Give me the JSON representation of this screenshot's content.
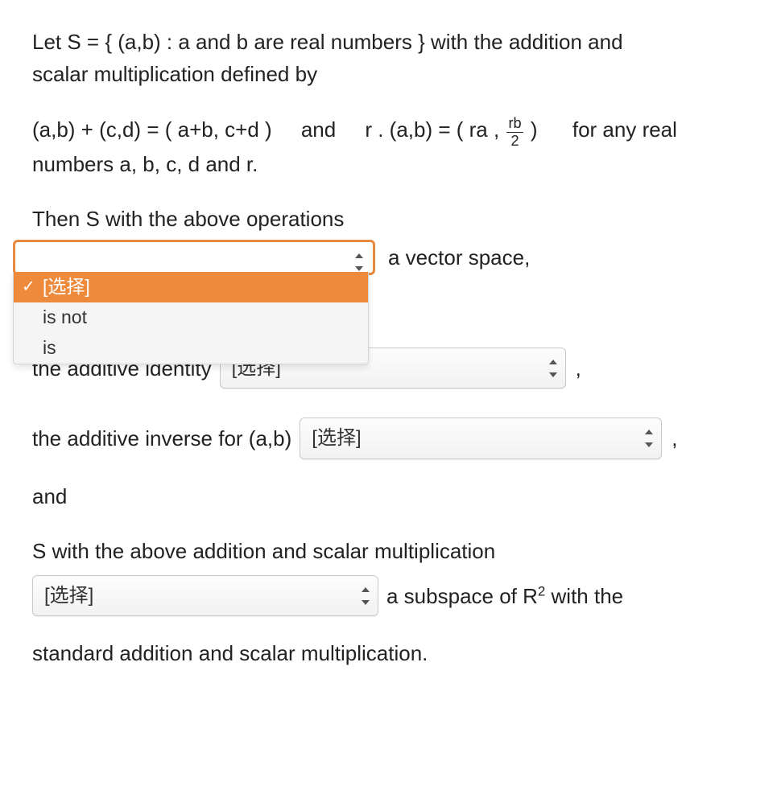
{
  "text": {
    "p1a": "Let S = { (a,b) : a and b are real numbers } with the addition and",
    "p1b": "scalar multiplication defined by",
    "eq_add": "(a,b) + (c,d) = ( a+b, c+d )",
    "eq_and": "and",
    "eq_scl_pre": "r . (a,b) = ( ra ,",
    "eq_scl_post": ")",
    "frac_num": "rb",
    "frac_den": "2",
    "eq_tail": "for any real",
    "p2": "numbers a, b, c, d and r.",
    "p3": "Then S with the above operations",
    "after_sel1": "a vector space,",
    "p4_pre": "the additive identity",
    "p4_comma": ",",
    "p5_pre": "the additive inverse for (a,b)",
    "p5_comma": ",",
    "p6": "and",
    "p7": "S with the above addition and scalar multiplication",
    "p8_post_a": "a subspace of R",
    "p8_sup": "2",
    "p8_post_b": " with the",
    "p9": "standard addition and scalar multiplication."
  },
  "selects": {
    "placeholder": "[选择]",
    "sel1": {
      "value": "[选择]",
      "options": [
        "[选择]",
        "is not",
        "is"
      ],
      "highlighted": "[选择]"
    },
    "sel2": {
      "value": "[选择]"
    },
    "sel3": {
      "value": "[选择]"
    },
    "sel4": {
      "value": "[选择]"
    }
  },
  "icons": {
    "check": "✓"
  }
}
